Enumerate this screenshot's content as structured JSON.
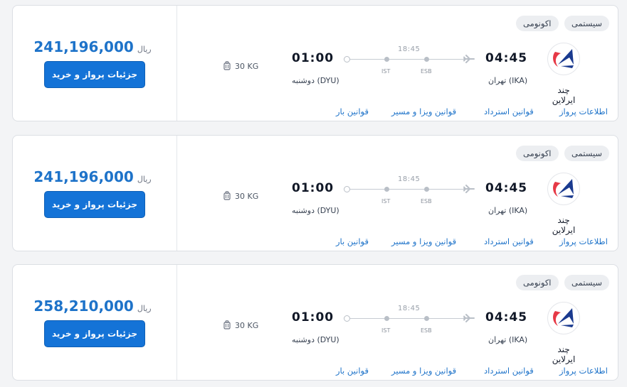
{
  "common": {
    "currency": "ریال",
    "buy_button": "جزئیات پرواز و خرید",
    "baggage": "30 KG",
    "airline": "چند ایرلاین",
    "badge_type": "سیستمی",
    "badge_class": "اکونومی",
    "departure_time": "04:45",
    "departure_city": "تهران (IKA)",
    "arrival_time": "01:00",
    "arrival_city": "دوشنبه (DYU)",
    "duration": "18:45",
    "stop_1": "ESB",
    "stop_2": "IST",
    "link_flight_info": "اطلاعات پرواز",
    "link_refund": "قوانین استرداد",
    "link_visa": "قوانین ویزا و مسیر",
    "link_baggage": "قوانین بار"
  },
  "flights": [
    {
      "price": "241,196,000"
    },
    {
      "price": "241,196,000"
    },
    {
      "price": "258,210,000"
    }
  ],
  "colors": {
    "accent": "#1473d7",
    "price": "#1e73c9",
    "logo_blue": "#1a3a8f",
    "logo_red": "#e63946"
  },
  "icons": {
    "baggage": "luggage-icon",
    "plane": "airplane-icon",
    "logo": "airline-logo"
  }
}
